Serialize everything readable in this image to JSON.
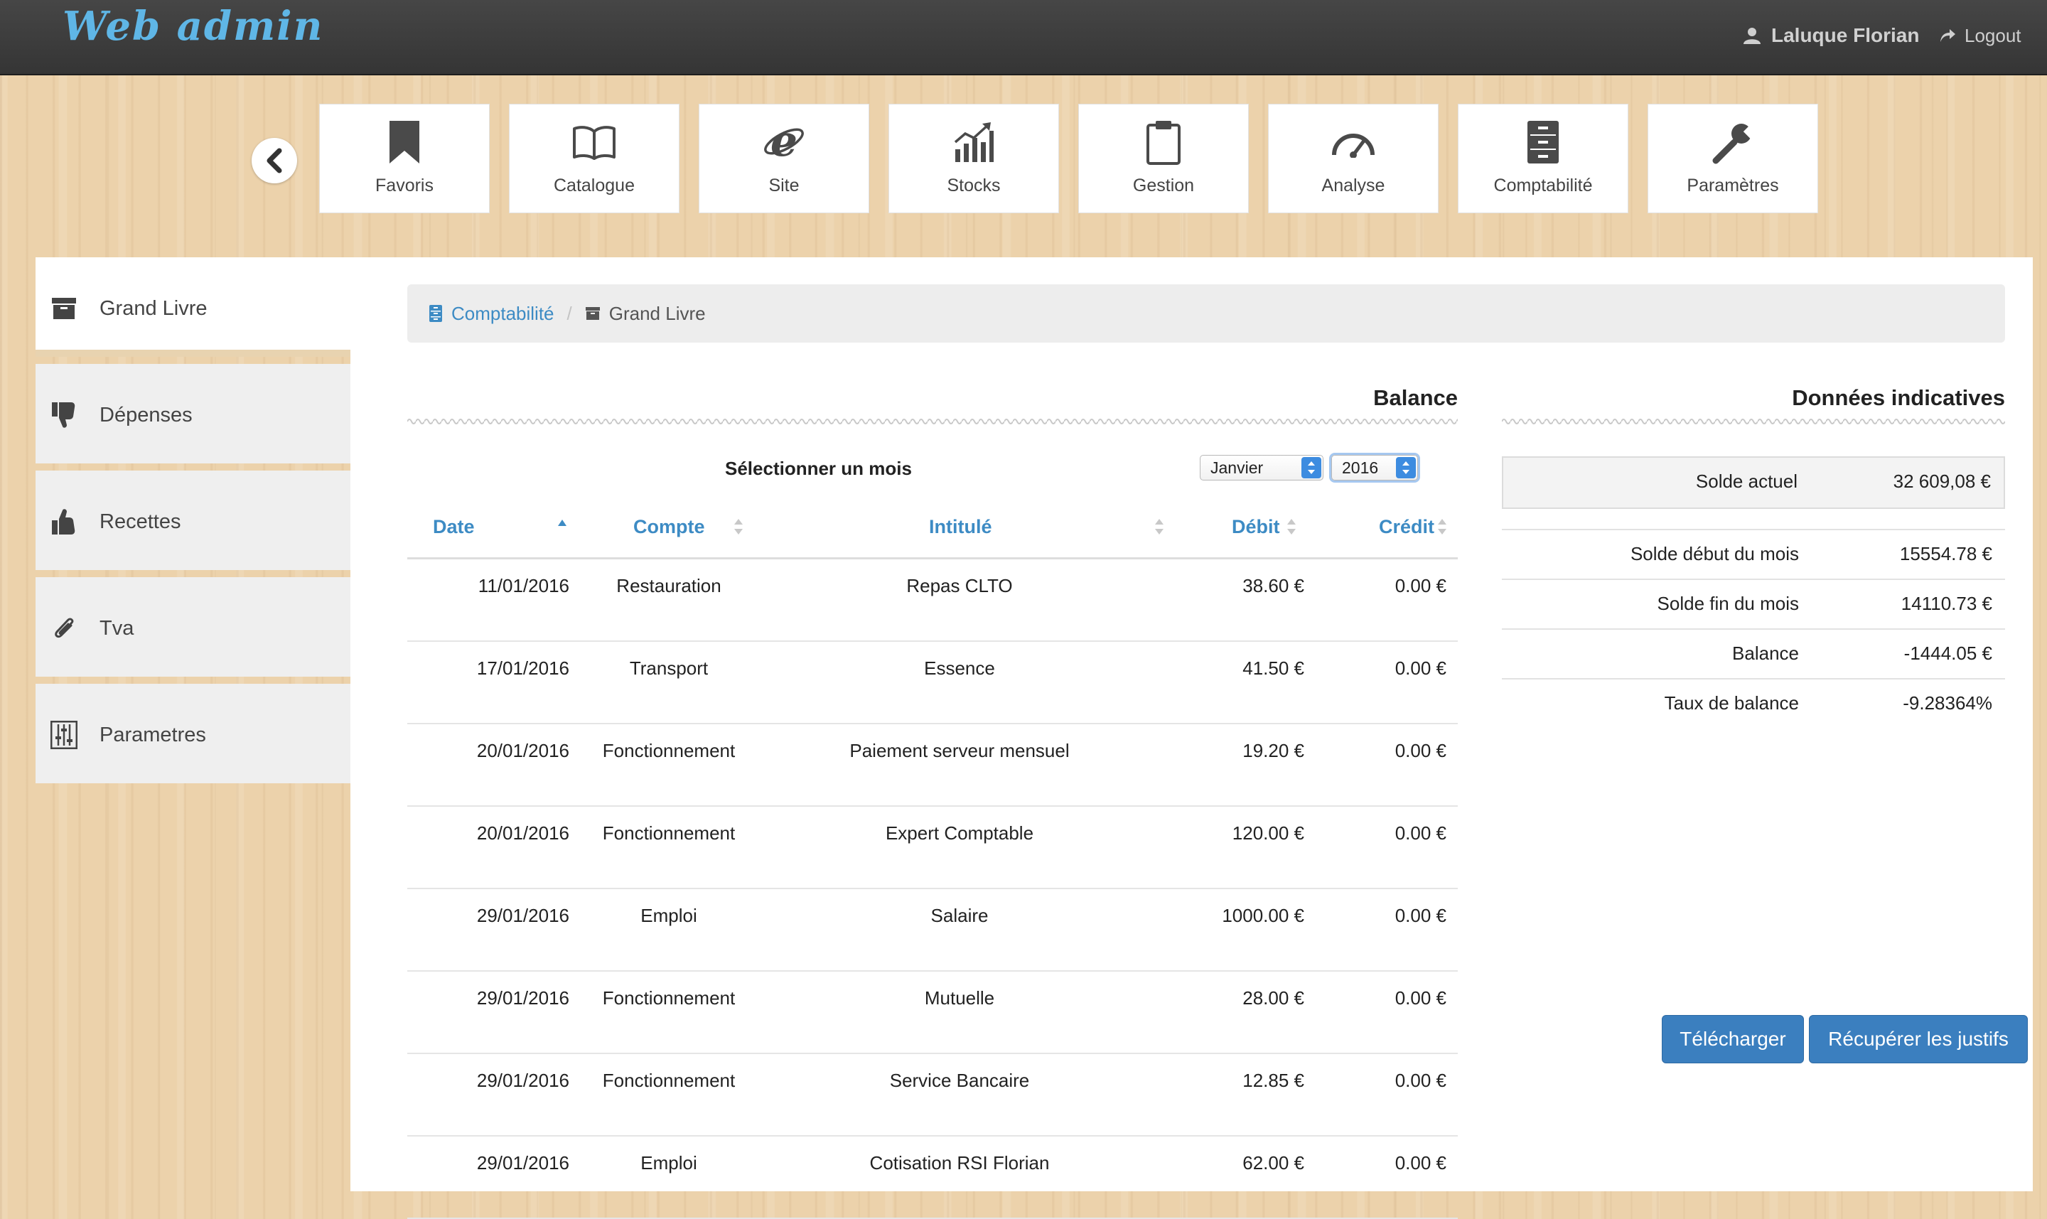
{
  "app": {
    "brand": "Web admin"
  },
  "header": {
    "user_name": "Laluque Florian",
    "logout_label": "Logout"
  },
  "modules": [
    {
      "label": "Favoris",
      "icon": "bookmark-icon"
    },
    {
      "label": "Catalogue",
      "icon": "open-book-icon"
    },
    {
      "label": "Site",
      "icon": "internet-explorer-icon"
    },
    {
      "label": "Stocks",
      "icon": "bar-chart-icon"
    },
    {
      "label": "Gestion",
      "icon": "clipboard-icon"
    },
    {
      "label": "Analyse",
      "icon": "dashboard-gauge-icon"
    },
    {
      "label": "Comptabilité",
      "icon": "filing-cabinet-icon"
    },
    {
      "label": "Paramètres",
      "icon": "wrench-icon"
    }
  ],
  "sidebar": {
    "items": [
      {
        "label": "Grand Livre",
        "icon": "archive-box-icon",
        "active": true
      },
      {
        "label": "Dépenses",
        "icon": "thumbs-down-icon"
      },
      {
        "label": "Recettes",
        "icon": "thumbs-up-icon"
      },
      {
        "label": "Tva",
        "icon": "paperclip-icon"
      },
      {
        "label": "Parametres",
        "icon": "sliders-icon"
      }
    ]
  },
  "breadcrumb": {
    "parent": "Comptabilité",
    "separator": "/",
    "current": "Grand Livre"
  },
  "balance": {
    "title": "Balance",
    "month_label": "Sélectionner un mois",
    "month_value": "Janvier",
    "year_value": "2016",
    "columns": [
      "Date",
      "Compte",
      "Intitulé",
      "Débit",
      "Crédit"
    ],
    "rows": [
      {
        "date": "11/01/2016",
        "compte": "Restauration",
        "intitule": "Repas CLTO",
        "debit": "38.60 €",
        "credit": "0.00 €"
      },
      {
        "date": "17/01/2016",
        "compte": "Transport",
        "intitule": "Essence",
        "debit": "41.50 €",
        "credit": "0.00 €"
      },
      {
        "date": "20/01/2016",
        "compte": "Fonctionnement",
        "intitule": "Paiement serveur mensuel",
        "debit": "19.20 €",
        "credit": "0.00 €"
      },
      {
        "date": "20/01/2016",
        "compte": "Fonctionnement",
        "intitule": "Expert Comptable",
        "debit": "120.00 €",
        "credit": "0.00 €"
      },
      {
        "date": "29/01/2016",
        "compte": "Emploi",
        "intitule": "Salaire",
        "debit": "1000.00 €",
        "credit": "0.00 €"
      },
      {
        "date": "29/01/2016",
        "compte": "Fonctionnement",
        "intitule": "Mutuelle",
        "debit": "28.00 €",
        "credit": "0.00 €"
      },
      {
        "date": "29/01/2016",
        "compte": "Fonctionnement",
        "intitule": "Service Bancaire",
        "debit": "12.85 €",
        "credit": "0.00 €"
      },
      {
        "date": "29/01/2016",
        "compte": "Emploi",
        "intitule": "Cotisation RSI Florian",
        "debit": "62.00 €",
        "credit": "0.00 €"
      }
    ]
  },
  "indicatives": {
    "title": "Données indicatives",
    "solde_actuel": {
      "label": "Solde actuel",
      "value": "32 609,08 €"
    },
    "rows": [
      {
        "label": "Solde début du mois",
        "value": "15554.78 €"
      },
      {
        "label": "Solde fin du mois",
        "value": "14110.73 €"
      },
      {
        "label": "Balance",
        "value": "-1444.05 €"
      },
      {
        "label": "Taux de balance",
        "value": "-9.28364%"
      }
    ],
    "download_label": "Télécharger",
    "fetch_label": "Récupérer les justifs"
  },
  "colors": {
    "accent": "#3d8bc4",
    "button": "#3b7fbf",
    "topbar": "#3d3d3d",
    "brand": "#5fb6e6"
  }
}
